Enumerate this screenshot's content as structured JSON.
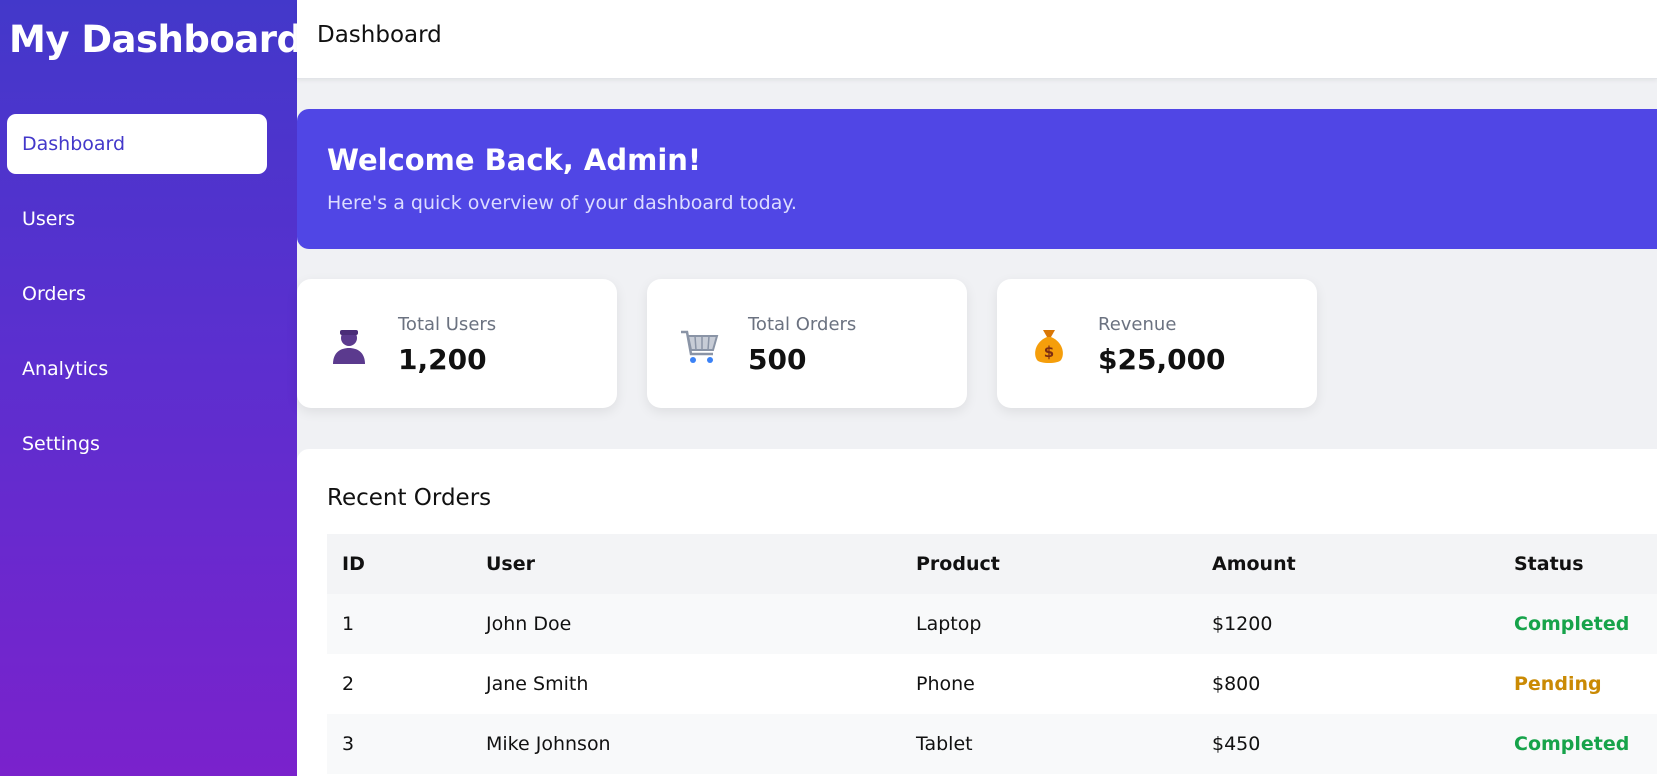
{
  "sidebar": {
    "brand": "My Dashboard",
    "items": [
      {
        "label": "Dashboard",
        "active": true
      },
      {
        "label": "Users"
      },
      {
        "label": "Orders"
      },
      {
        "label": "Analytics"
      },
      {
        "label": "Settings"
      }
    ]
  },
  "topbar": {
    "title": "Dashboard"
  },
  "welcome": {
    "title": "Welcome Back, Admin!",
    "subtitle": "Here's a quick overview of your dashboard today."
  },
  "stats": [
    {
      "icon": "user-icon",
      "label": "Total Users",
      "value": "1,200"
    },
    {
      "icon": "shopping-cart-icon",
      "label": "Total Orders",
      "value": "500"
    },
    {
      "icon": "money-bag-icon",
      "label": "Revenue",
      "value": "$25,000"
    }
  ],
  "orders": {
    "title": "Recent Orders",
    "columns": [
      "ID",
      "User",
      "Product",
      "Amount",
      "Status"
    ],
    "rows": [
      {
        "id": "1",
        "user": "John Doe",
        "product": "Laptop",
        "amount": "$1200",
        "status": "Completed"
      },
      {
        "id": "2",
        "user": "Jane Smith",
        "product": "Phone",
        "amount": "$800",
        "status": "Pending"
      },
      {
        "id": "3",
        "user": "Mike Johnson",
        "product": "Tablet",
        "amount": "$450",
        "status": "Completed"
      }
    ]
  },
  "colors": {
    "accent": "#5046e5",
    "sidebar_top": "#4338ca",
    "sidebar_bottom": "#7a22cc",
    "status_completed": "#16a34a",
    "status_pending": "#ca8a04"
  }
}
